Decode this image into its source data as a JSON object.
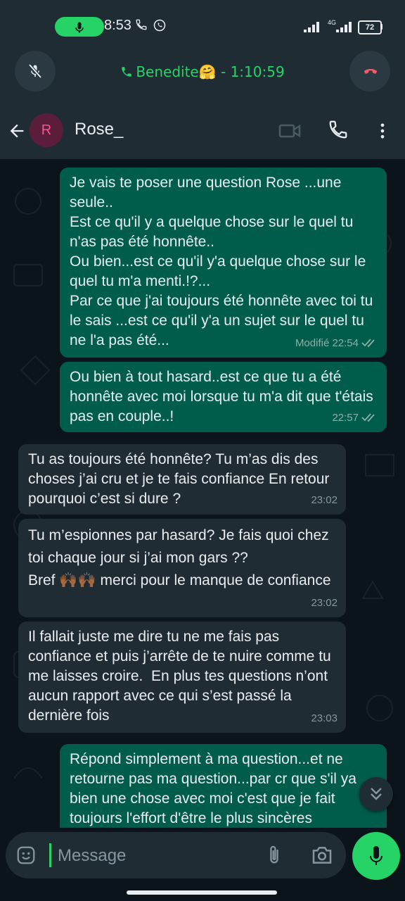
{
  "status_bar": {
    "time": "8:53",
    "battery": "72",
    "network": "4G"
  },
  "call": {
    "label": "Benedite🤗 - 1:10:59"
  },
  "header": {
    "avatar_letter": "R",
    "contact_name": "Rose_"
  },
  "messages": [
    {
      "direction": "out",
      "text": "Je vais te poser une question Rose ...une seule..\nEst ce qu'il y a quelque chose sur le quel tu n'as pas été honnête..\nOu bien...est ce qu'il y'a quelque chose sur le quel tu m'a menti.!?...\nPar ce que j'ai toujours été honnête avec toi tu le sais ...est ce qu'il y'a un sujet sur le quel tu ne l'a pas été...",
      "meta": "Modifié 22:54"
    },
    {
      "direction": "out",
      "text": "Ou bien à tout hasard..est ce que tu a été honnête avec moi lorsque tu m'a dit que t'étais pas en couple..!",
      "meta": "22:57"
    },
    {
      "direction": "in",
      "text": "Tu as toujours été honnête? Tu m’as dis des choses j’ai cru et je te fais confiance En retour pourquoi c’est si dure ?",
      "meta": "23:02"
    },
    {
      "direction": "in",
      "text": "Tu m’espionnes par hasard? Je fais quoi chez toi chaque jour si j’ai mon gars ??\nBref 🙌🏾🙌🏾 merci pour le manque de confiance",
      "meta": "23:02"
    },
    {
      "direction": "in",
      "text": "Il fallait juste me dire tu ne me fais pas confiance et puis j’arrête de te nuire comme tu me laisses croire.  En plus tes questions n’ont aucun rapport avec ce qui s’est passé la dernière fois",
      "meta": "23:03"
    },
    {
      "direction": "out",
      "text": "Répond simplement à ma question...et ne retourne pas ma question...par cr que s'il ya bien une chose avec moi c'est que je fait toujours l'effort d'être le plus sincères",
      "meta": ""
    }
  ],
  "input": {
    "placeholder": "Message"
  },
  "icons": {
    "status_mic": "microphone-icon",
    "mute": "microphone-off-icon",
    "hangup": "phone-hangup-icon",
    "back": "arrow-left-icon",
    "video": "video-camera-icon",
    "voice_call": "phone-icon",
    "menu": "more-vertical-icon",
    "emoji": "emoji-icon",
    "attach": "paperclip-icon",
    "camera": "camera-icon",
    "mic": "microphone-icon",
    "scroll_down": "double-chevron-down-icon"
  },
  "colors": {
    "accent": "#25d366",
    "outgoing_bubble": "#005c4b",
    "incoming_bubble": "#202c33",
    "background": "#0b141a"
  }
}
